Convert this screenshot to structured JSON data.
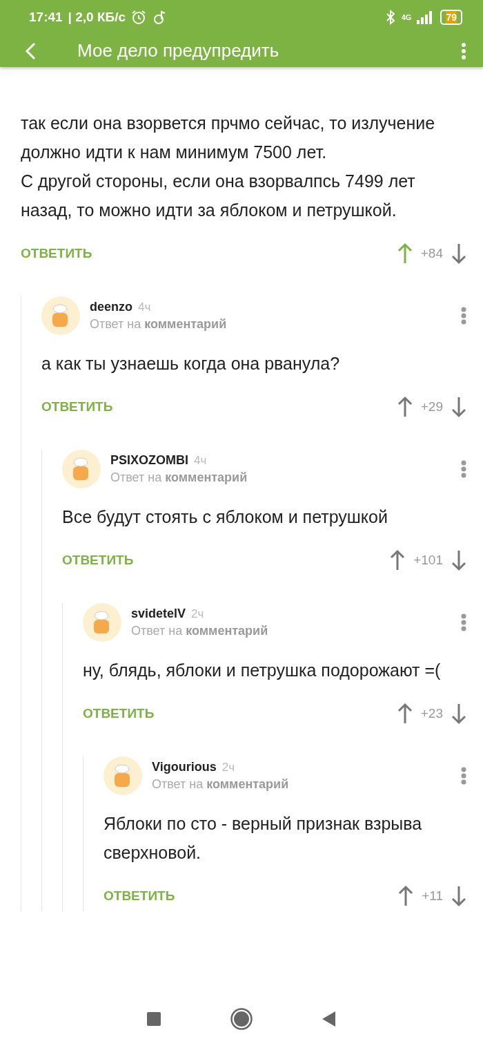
{
  "status_bar": {
    "time": "17:41",
    "speed": "| 2,0 КБ/с",
    "network": "4G",
    "battery": "79"
  },
  "app_bar": {
    "title": "Мое дело предупредить"
  },
  "thread": {
    "text": "так если она взорвется прчмо сейчас, то излучение должно идти к нам минимум 7500 лет.\nС другой стороны, если она взорвалпсь 7499 лет назад, то можно идти за яблоком и петрушкой.",
    "reply": "ОТВЕТИТЬ",
    "score": "+84",
    "voted_up": true,
    "children": [
      {
        "author": "deenzo",
        "time": "4ч",
        "reply_to": "Ответ на **комментарий**",
        "text": "а как ты узнаешь когда она рванула?",
        "reply": "ОТВЕТИТЬ",
        "score": "+29",
        "voted_up": false,
        "children": [
          {
            "author": "PSIXOZOMBI",
            "time": "4ч",
            "reply_to": "Ответ на **комментарий**",
            "text": "Все будут стоять с яблоком и петрушкой",
            "reply": "ОТВЕТИТЬ",
            "score": "+101",
            "voted_up": false,
            "children": [
              {
                "author": "svidetelV",
                "time": "2ч",
                "reply_to": "Ответ на **комментарий**",
                "text": "ну, блядь, яблоки и петрушка подорожают =(",
                "reply": "ОТВЕТИТЬ",
                "score": "+23",
                "voted_up": false,
                "children": [
                  {
                    "author": "Vigourious",
                    "time": "2ч",
                    "reply_to": "Ответ на **комментарий**",
                    "text": "Яблоки по сто - верный признак взрыва сверхновой.",
                    "reply": "ОТВЕТИТЬ",
                    "score": "+11",
                    "voted_up": false
                  }
                ]
              }
            ]
          }
        ]
      }
    ]
  }
}
